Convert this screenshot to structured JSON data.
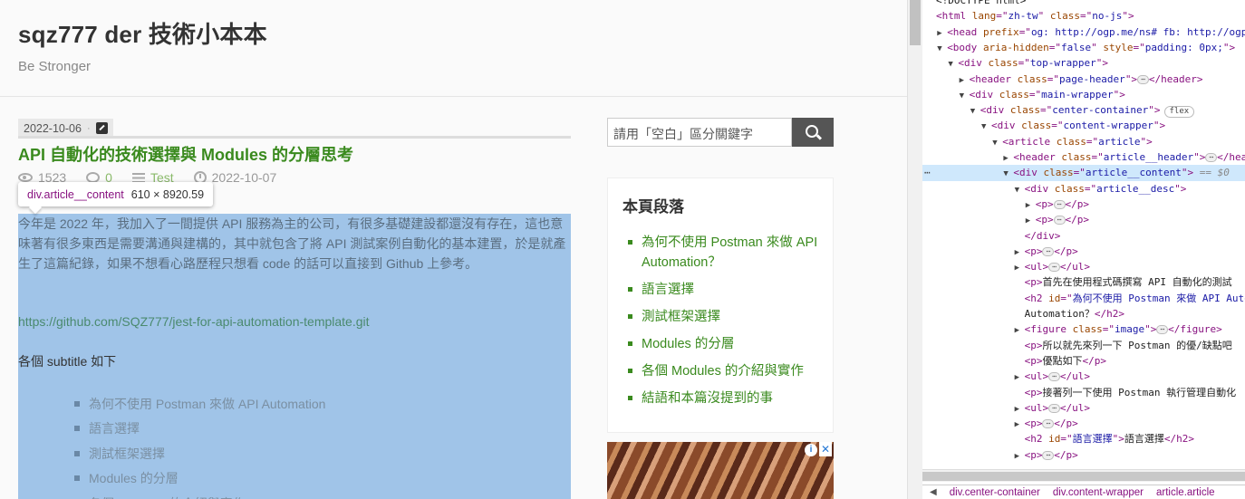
{
  "site": {
    "title": "sqz777 der 技術小本本",
    "subtitle": "Be Stronger"
  },
  "post": {
    "date": "2022-10-06",
    "title": "API 自動化的技術選擇與 Modules 的分層思考",
    "views": "1523",
    "comments": "0",
    "category": "Test",
    "updated": "2022-10-07"
  },
  "tooltip": {
    "name": "div.article__content",
    "size": "610 × 8920.59"
  },
  "content": {
    "paragraph": "今年是 2022 年，我加入了一間提供 API 服務為主的公司，有很多基礎建設都還沒有存在，這也意味著有很多東西是需要溝通與建構的，其中就包含了將 API 測試案例自動化的基本建置，於是就產生了這篇紀錄，如果不想看心路歷程只想看 code 的話可以直接到 Github 上參考。",
    "link": "https://github.com/SQZ777/jest-for-api-automation-template.git",
    "subtitle_line": "各個 subtitle 如下",
    "list": [
      "為何不使用 Postman 來做 API Automation",
      "語言選擇",
      "測試框架選擇",
      "Modules 的分層",
      "各個 Modules 的介紹與實作"
    ]
  },
  "search": {
    "placeholder": "請用「空白」區分關鍵字"
  },
  "toc": {
    "title": "本頁段落",
    "items": [
      "為何不使用 Postman 來做 API Automation？",
      "語言選擇",
      "測試框架選擇",
      "Modules 的分層",
      "各個 Modules 的介紹與實作",
      "結語和本篇沒提到的事"
    ]
  },
  "devtools": {
    "lines": [
      {
        "indent": 0,
        "tri": "",
        "parts": [
          [
            "txt",
            "<!DOCTYPE html>"
          ]
        ]
      },
      {
        "indent": 0,
        "tri": "",
        "parts": [
          [
            "tag",
            "<html "
          ],
          [
            "attr",
            "lang"
          ],
          [
            "tag",
            "=\""
          ],
          [
            "val",
            "zh-tw"
          ],
          [
            "tag",
            "\" "
          ],
          [
            "attr",
            "class"
          ],
          [
            "tag",
            "=\""
          ],
          [
            "val",
            "no-js"
          ],
          [
            "tag",
            "\">"
          ]
        ]
      },
      {
        "indent": 1,
        "tri": "▶",
        "parts": [
          [
            "tag",
            "<head "
          ],
          [
            "attr",
            "prefix"
          ],
          [
            "tag",
            "=\""
          ],
          [
            "val",
            "og: http://ogp.me/ns# fb: http://ogp.me/ns/fb#"
          ],
          [
            "tag",
            "\">"
          ]
        ]
      },
      {
        "indent": 1,
        "tri": "▼",
        "parts": [
          [
            "tag",
            "<body "
          ],
          [
            "attr",
            "aria-hidden"
          ],
          [
            "tag",
            "=\""
          ],
          [
            "val",
            "false"
          ],
          [
            "tag",
            "\" "
          ],
          [
            "attr",
            "style"
          ],
          [
            "tag",
            "=\""
          ],
          [
            "val",
            "padding: 0px;"
          ],
          [
            "tag",
            "\">"
          ]
        ]
      },
      {
        "indent": 2,
        "tri": "▼",
        "parts": [
          [
            "tag",
            "<div "
          ],
          [
            "attr",
            "class"
          ],
          [
            "tag",
            "=\""
          ],
          [
            "val",
            "top-wrapper"
          ],
          [
            "tag",
            "\">"
          ]
        ]
      },
      {
        "indent": 3,
        "tri": "▶",
        "parts": [
          [
            "tag",
            "<header "
          ],
          [
            "attr",
            "class"
          ],
          [
            "tag",
            "=\""
          ],
          [
            "val",
            "page-header"
          ],
          [
            "tag",
            "\">"
          ],
          [
            "ell",
            "⋯"
          ],
          [
            "tag",
            "</header>"
          ]
        ]
      },
      {
        "indent": 3,
        "tri": "▼",
        "parts": [
          [
            "tag",
            "<div "
          ],
          [
            "attr",
            "class"
          ],
          [
            "tag",
            "=\""
          ],
          [
            "val",
            "main-wrapper"
          ],
          [
            "tag",
            "\">"
          ]
        ]
      },
      {
        "indent": 4,
        "tri": "▼",
        "parts": [
          [
            "tag",
            "<div "
          ],
          [
            "attr",
            "class"
          ],
          [
            "tag",
            "=\""
          ],
          [
            "val",
            "center-container"
          ],
          [
            "tag",
            "\">"
          ],
          [
            "flex",
            "flex"
          ]
        ]
      },
      {
        "indent": 5,
        "tri": "▼",
        "parts": [
          [
            "tag",
            "<div "
          ],
          [
            "attr",
            "class"
          ],
          [
            "tag",
            "=\""
          ],
          [
            "val",
            "content-wrapper"
          ],
          [
            "tag",
            "\">"
          ]
        ]
      },
      {
        "indent": 6,
        "tri": "▼",
        "parts": [
          [
            "tag",
            "<article "
          ],
          [
            "attr",
            "class"
          ],
          [
            "tag",
            "=\""
          ],
          [
            "val",
            "article"
          ],
          [
            "tag",
            "\">"
          ]
        ]
      },
      {
        "indent": 7,
        "tri": "▶",
        "parts": [
          [
            "tag",
            "<header "
          ],
          [
            "attr",
            "class"
          ],
          [
            "tag",
            "=\""
          ],
          [
            "val",
            "article__header"
          ],
          [
            "tag",
            "\">"
          ],
          [
            "ell",
            "⋯"
          ],
          [
            "tag",
            "</header>"
          ]
        ]
      },
      {
        "indent": 7,
        "tri": "▼",
        "sel": true,
        "parts": [
          [
            "tag",
            "<div "
          ],
          [
            "attr",
            "class"
          ],
          [
            "tag",
            "=\""
          ],
          [
            "val",
            "article__content"
          ],
          [
            "tag",
            "\">"
          ],
          [
            "eq",
            " == $0"
          ]
        ]
      },
      {
        "indent": 8,
        "tri": "▼",
        "parts": [
          [
            "tag",
            "<div "
          ],
          [
            "attr",
            "class"
          ],
          [
            "tag",
            "=\""
          ],
          [
            "val",
            "article__desc"
          ],
          [
            "tag",
            "\">"
          ]
        ]
      },
      {
        "indent": 9,
        "tri": "▶",
        "parts": [
          [
            "tag",
            "<p>"
          ],
          [
            "ell",
            "⋯"
          ],
          [
            "tag",
            "</p>"
          ]
        ]
      },
      {
        "indent": 9,
        "tri": "▶",
        "parts": [
          [
            "tag",
            "<p>"
          ],
          [
            "ell",
            "⋯"
          ],
          [
            "tag",
            "</p>"
          ]
        ]
      },
      {
        "indent": 8,
        "tri": "",
        "parts": [
          [
            "tag",
            "</div>"
          ]
        ]
      },
      {
        "indent": 8,
        "tri": "▶",
        "parts": [
          [
            "tag",
            "<p>"
          ],
          [
            "ell",
            "⋯"
          ],
          [
            "tag",
            "</p>"
          ]
        ]
      },
      {
        "indent": 8,
        "tri": "▶",
        "parts": [
          [
            "tag",
            "<ul>"
          ],
          [
            "ell",
            "⋯"
          ],
          [
            "tag",
            "</ul>"
          ]
        ]
      },
      {
        "indent": 8,
        "tri": "",
        "parts": [
          [
            "tag",
            "<p>"
          ],
          [
            "txt",
            "首先在使用程式碼撰寫 API 自動化的測試"
          ]
        ]
      },
      {
        "indent": 8,
        "tri": "",
        "parts": [
          [
            "tag",
            "<h2 "
          ],
          [
            "attr",
            "id"
          ],
          [
            "tag",
            "=\""
          ],
          [
            "val",
            "為何不使用 Postman 來做 API Automation"
          ],
          [
            "tag",
            "\">"
          ]
        ]
      },
      {
        "indent": 8,
        "tri": "",
        "parts": [
          [
            "txt",
            "Automation？"
          ],
          [
            "tag",
            "</h2>"
          ]
        ]
      },
      {
        "indent": 8,
        "tri": "▶",
        "parts": [
          [
            "tag",
            "<figure "
          ],
          [
            "attr",
            "class"
          ],
          [
            "tag",
            "=\""
          ],
          [
            "val",
            "image"
          ],
          [
            "tag",
            "\">"
          ],
          [
            "ell",
            "⋯"
          ],
          [
            "tag",
            "</figure>"
          ]
        ]
      },
      {
        "indent": 8,
        "tri": "",
        "parts": [
          [
            "tag",
            "<p>"
          ],
          [
            "txt",
            "所以就先來列一下 Postman 的優/缺點吧"
          ]
        ]
      },
      {
        "indent": 8,
        "tri": "",
        "parts": [
          [
            "tag",
            "<p>"
          ],
          [
            "txt",
            "優點如下"
          ],
          [
            "tag",
            "</p>"
          ]
        ]
      },
      {
        "indent": 8,
        "tri": "▶",
        "parts": [
          [
            "tag",
            "<ul>"
          ],
          [
            "ell",
            "⋯"
          ],
          [
            "tag",
            "</ul>"
          ]
        ]
      },
      {
        "indent": 8,
        "tri": "",
        "parts": [
          [
            "tag",
            "<p>"
          ],
          [
            "txt",
            "接著列一下使用 Postman 執行管理自動化"
          ]
        ]
      },
      {
        "indent": 8,
        "tri": "▶",
        "parts": [
          [
            "tag",
            "<ul>"
          ],
          [
            "ell",
            "⋯"
          ],
          [
            "tag",
            "</ul>"
          ]
        ]
      },
      {
        "indent": 8,
        "tri": "▶",
        "parts": [
          [
            "tag",
            "<p>"
          ],
          [
            "ell",
            "⋯"
          ],
          [
            "tag",
            "</p>"
          ]
        ]
      },
      {
        "indent": 8,
        "tri": "",
        "parts": [
          [
            "tag",
            "<h2 "
          ],
          [
            "attr",
            "id"
          ],
          [
            "tag",
            "=\""
          ],
          [
            "val",
            "語言選擇"
          ],
          [
            "tag",
            "\">"
          ],
          [
            "txt",
            "語言選擇"
          ],
          [
            "tag",
            "</h2>"
          ]
        ]
      },
      {
        "indent": 8,
        "tri": "▶",
        "parts": [
          [
            "tag",
            "<p>"
          ],
          [
            "ell",
            "⋯"
          ],
          [
            "tag",
            "</p>"
          ]
        ]
      }
    ],
    "breadcrumbs": [
      "div.center-container",
      "div.content-wrapper",
      "article.article"
    ]
  }
}
